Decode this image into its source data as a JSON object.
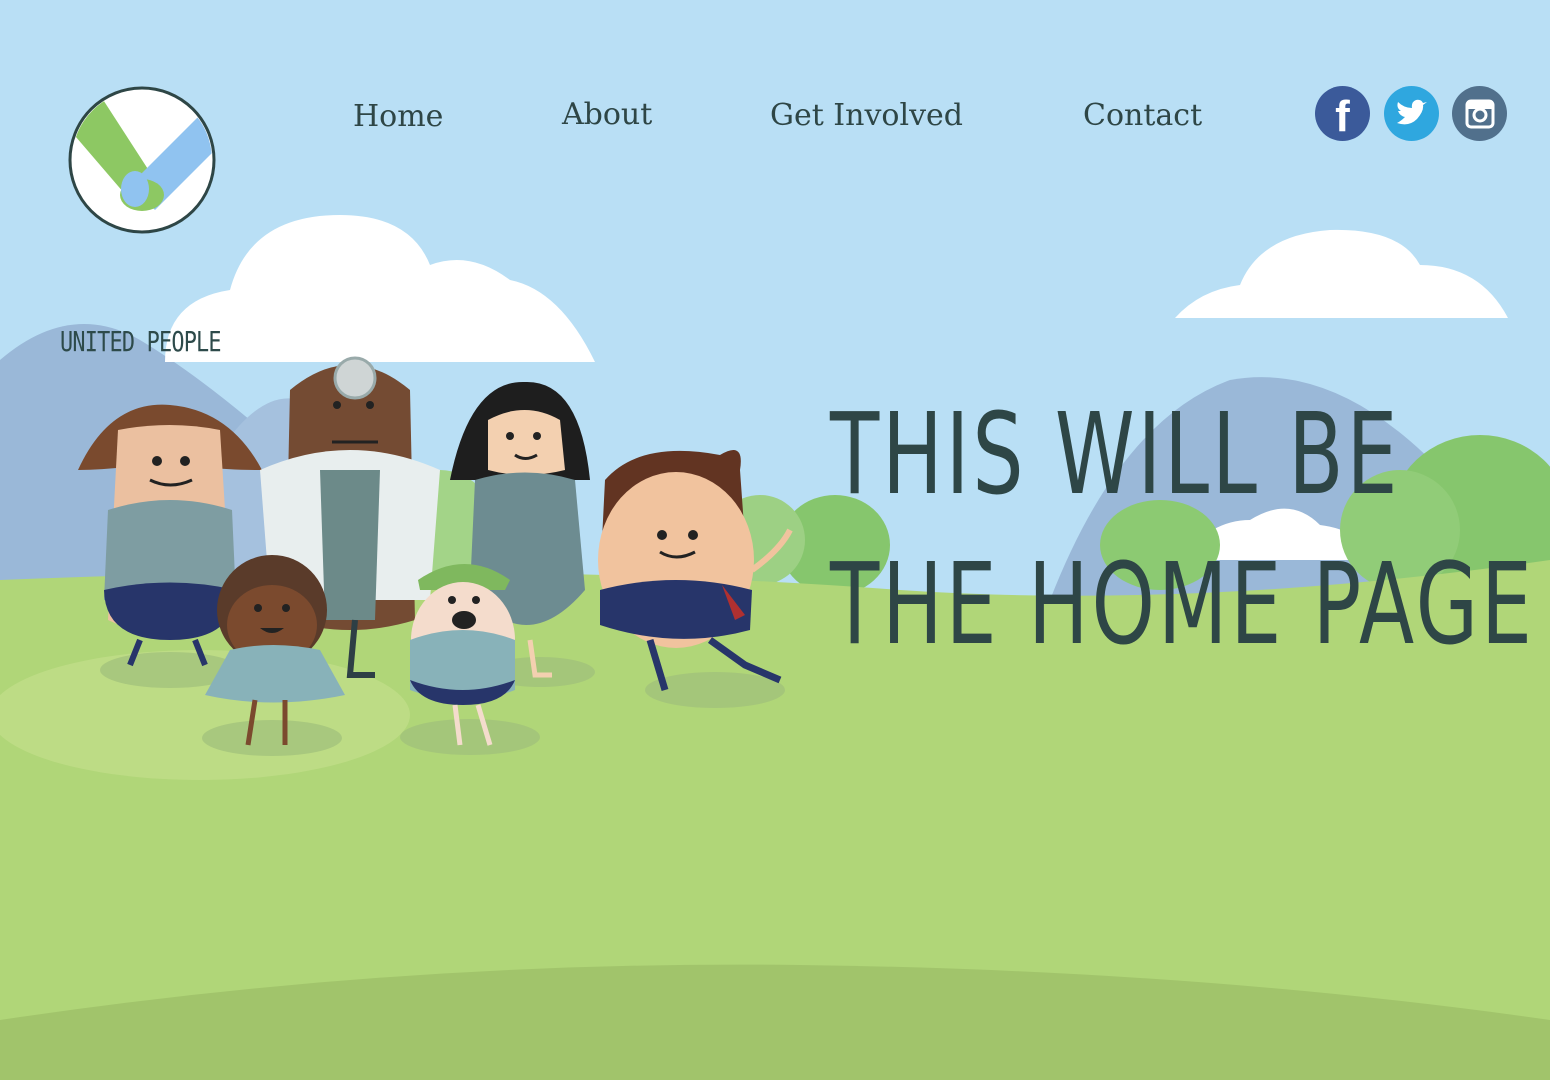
{
  "brand": {
    "name": "UNITED PEOPLE"
  },
  "nav": {
    "items": [
      {
        "label": "Home"
      },
      {
        "label": "About"
      },
      {
        "label": "Get Involved"
      },
      {
        "label": "Contact"
      }
    ]
  },
  "social": [
    {
      "icon": "facebook-icon",
      "color": "#3b5a9a"
    },
    {
      "icon": "twitter-icon",
      "color": "#2fa7df"
    },
    {
      "icon": "instagram-icon",
      "color": "#51708c"
    }
  ],
  "hero": {
    "line1": "THIS WILL BE",
    "line2": "THE HOME PAGE"
  },
  "colors": {
    "sky": "#b9dff5",
    "grass": "#b0d678",
    "text": "#2e4646"
  }
}
